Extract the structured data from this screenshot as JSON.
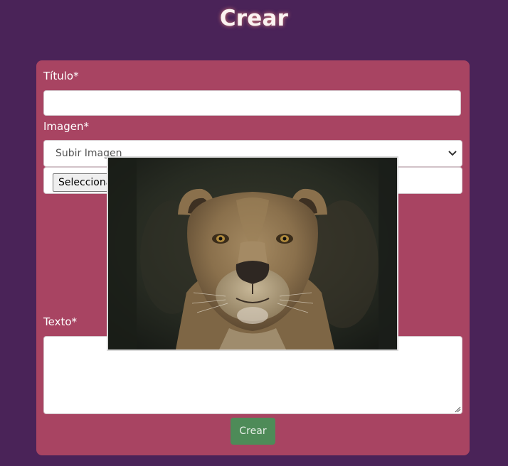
{
  "page": {
    "title": "Crear"
  },
  "form": {
    "title_label": "Título*",
    "title_value": "",
    "image_label": "Imagen*",
    "image_select": {
      "selected": "Subir Imagen"
    },
    "file_button_label": "Seleccionar archivo",
    "text_label": "Texto*",
    "text_value": "",
    "submit_label": "Crear"
  },
  "preview": {
    "subject": "lioness photo"
  },
  "colors": {
    "background": "#4a2358",
    "card": "#a84462",
    "submit": "#4e8b58",
    "title_glow": "#ff9682"
  },
  "icons": {
    "select_arrow": "chevron-down-icon",
    "textarea_resize": "resize-grip-icon"
  }
}
